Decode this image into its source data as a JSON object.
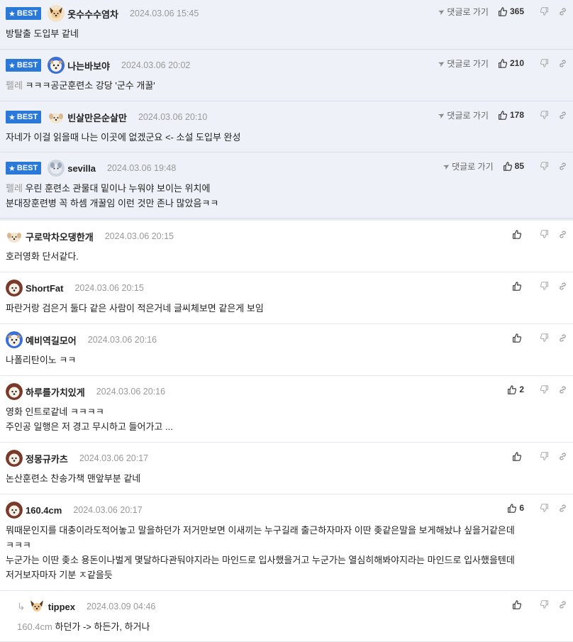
{
  "labels": {
    "best": "BEST",
    "reply_go": "댓글로 가기"
  },
  "comments": [
    {
      "nick": "옷수수수염차",
      "date": "2024.03.06 15:45",
      "best": true,
      "likes": "365",
      "lines": [
        "방탈출 도입부 같네"
      ],
      "ref": ""
    },
    {
      "nick": "나는바보야",
      "date": "2024.03.06 20:02",
      "best": true,
      "likes": "210",
      "ref": "펠레",
      "lines": [
        " ㅋㅋㅋ공군훈련소 강당 '군수 개꿀'"
      ]
    },
    {
      "nick": "빈살만은순살만",
      "date": "2024.03.06 20:10",
      "best": true,
      "likes": "178",
      "lines": [
        "자네가 이걸 읽을때 나는 이곳에 없겠군요 <- 소설 도입부 완성"
      ],
      "ref": ""
    },
    {
      "nick": "sevilla",
      "date": "2024.03.06 19:48",
      "best": true,
      "likes": "85",
      "ref": "펠레",
      "lines": [
        " 우린 훈련소 관물대 밑이나 누워야 보이는 위치에",
        "분대장훈련병 꼭 하셈 개꿀임 이런 것만 존나 많았음ㅋㅋ"
      ]
    },
    {
      "nick": "구로막차오댕한개",
      "date": "2024.03.06 20:15",
      "likes": "",
      "lines": [
        "호러영화 단서같다."
      ],
      "ref": ""
    },
    {
      "nick": "ShortFat",
      "date": "2024.03.06 20:15",
      "likes": "",
      "lines": [
        "파란거랑 검은거 둘다 같은 사람이 적은거네 글씨체보면 같은게 보임"
      ],
      "ref": ""
    },
    {
      "nick": "예비역길모어",
      "date": "2024.03.06 20:16",
      "likes": "",
      "lines": [
        "나폴리탄이노 ㅋㅋ"
      ],
      "ref": ""
    },
    {
      "nick": "하루를가치있게",
      "date": "2024.03.06 20:16",
      "likes": "2",
      "lines": [
        "영화 인트로같네 ㅋㅋㅋㅋ",
        "주인공 일행은 저 경고 무시하고 들어가고 ..."
      ],
      "ref": ""
    },
    {
      "nick": "정몽규카츠",
      "date": "2024.03.06 20:17",
      "likes": "",
      "lines": [
        "논산훈련소 찬송가책 맨앞부분 같네"
      ],
      "ref": ""
    },
    {
      "nick": "160.4cm",
      "date": "2024.03.06 20:17",
      "likes": "6",
      "lines": [
        "뭐때문인지를 대충이라도적어놓고 말을하던가 저거만보면 이새끼는 누구길래 출근하자마자 이딴 좆같은말을 보게해놨냐 싶을거같은데",
        "ㅋㅋㅋ",
        "누군가는 이딴 좆소 용돈이나벌게 몇달하다관둬야지라는 마인드로 입사했을거고 누군가는 열심히해봐야지라는 마인드로 입사했을텐데",
        "저거보자마자 기분 ㅈ같을듯"
      ],
      "ref": ""
    },
    {
      "nick": "tippex",
      "date": "2024.03.09 04:46",
      "likes": "",
      "reply": true,
      "ref": "160.4cm",
      "lines": [
        " 하던가 -> 하든가, 하거나"
      ]
    }
  ]
}
